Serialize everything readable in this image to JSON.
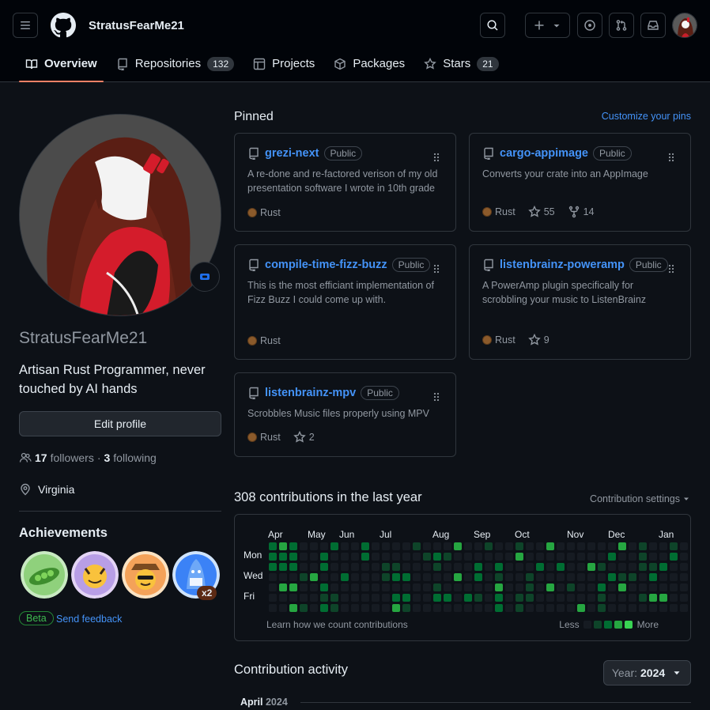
{
  "header": {
    "brand_name": "StratusFearMe21",
    "menu_icon": "hamburger-icon",
    "logo_icon": "github-logo-icon",
    "plus_icon": "plus-icon",
    "search_icon": "search-icon",
    "issues_icon": "issue-icon",
    "pulls_icon": "pull-request-icon",
    "inbox_icon": "inbox-icon"
  },
  "tabs": [
    {
      "label": "Overview",
      "icon": "book-icon",
      "active": true
    },
    {
      "label": "Repositories",
      "icon": "repo-icon",
      "count": "132"
    },
    {
      "label": "Projects",
      "icon": "table-icon"
    },
    {
      "label": "Packages",
      "icon": "package-icon"
    },
    {
      "label": "Stars",
      "icon": "star-icon",
      "count": "21"
    }
  ],
  "profile": {
    "username": "StratusFearMe21",
    "bio": "Artisan Rust Programmer, never touched by AI hands",
    "edit_label": "Edit profile",
    "followers_count": "17",
    "followers_label": "followers",
    "separator": "·",
    "following_count": "3",
    "following_label": "following",
    "location": "Virginia"
  },
  "achievements": {
    "title": "Achievements",
    "badges": [
      "pair-extraordinaire-icon",
      "quickdraw-icon",
      "yolo-icon",
      "pull-shark-icon"
    ],
    "multiplier": "x2",
    "beta_label": "Beta",
    "feedback_label": "Send feedback"
  },
  "pinned": {
    "title": "Pinned",
    "customize_label": "Customize your pins",
    "repos": [
      {
        "name": "grezi-next",
        "visibility": "Public",
        "description": "A re-done and re-factored verison of my old presentation software I wrote in 10th grade",
        "language": "Rust",
        "stars": "",
        "forks": ""
      },
      {
        "name": "cargo-appimage",
        "visibility": "Public",
        "description": "Converts your crate into an AppImage",
        "language": "Rust",
        "stars": "55",
        "forks": "14"
      },
      {
        "name": "compile-time-fizz-buzz",
        "visibility": "Public",
        "description": "This is the most efficiant implementation of Fizz Buzz I could come up with.",
        "language": "Rust",
        "stars": "",
        "forks": ""
      },
      {
        "name": "listenbrainz-poweramp",
        "visibility": "Public",
        "description": "A PowerAmp plugin specifically for scrobbling your music to ListenBrainz",
        "language": "Rust",
        "stars": "9",
        "forks": ""
      },
      {
        "name": "listenbrainz-mpv",
        "visibility": "Public",
        "description": "Scrobbles Music files properly using MPV",
        "language": "Rust",
        "stars": "2",
        "forks": ""
      }
    ],
    "language_color": "#8b5a2b"
  },
  "contributions": {
    "title": "308 contributions in the last year",
    "settings_label": "Contribution settings",
    "months": [
      "Apr",
      "May",
      "Jun",
      "Jul",
      "Aug",
      "Sep",
      "Oct",
      "Nov",
      "Dec",
      "Jan"
    ],
    "days": [
      "Mon",
      "Wed",
      "Fri"
    ],
    "learn_label": "Learn how we count contributions",
    "less_label": "Less",
    "more_label": "More",
    "level_colors": [
      "#161b22",
      "#0e4429",
      "#006d32",
      "#26a641",
      "#39d353"
    ]
  },
  "activity": {
    "title": "Contribution activity",
    "year_label": "Year:",
    "year_value": "2024",
    "month_label": "April",
    "month_year": "2024"
  }
}
